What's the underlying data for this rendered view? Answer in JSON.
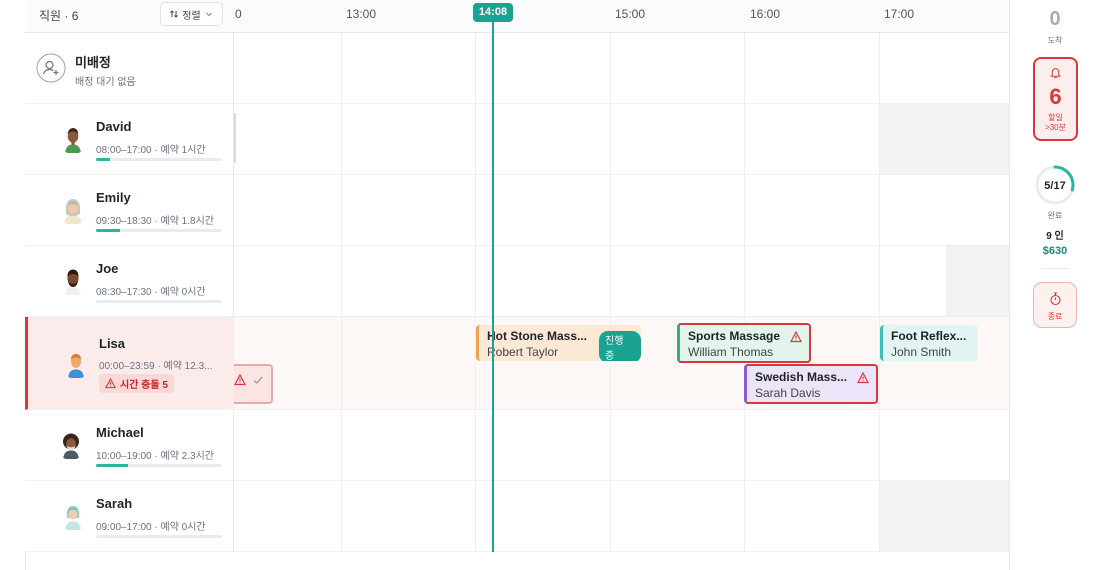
{
  "header": {
    "staff_title": "직원 · 6",
    "sort_label": "정렬",
    "time_ticks": [
      "0",
      "13:00",
      "14:00",
      "15:00",
      "16:00",
      "17:00"
    ],
    "now_time": "14:08"
  },
  "unassigned": {
    "title": "미배정",
    "subtitle": "배정 대기 없음"
  },
  "staff": [
    {
      "name": "David",
      "meta": "08:00–17:00 · 예약 1시간",
      "progress": 0.11
    },
    {
      "name": "Emily",
      "meta": "09:30–18:30 · 예약 1.8시간",
      "progress": 0.19
    },
    {
      "name": "Joe",
      "meta": "08:30–17:30 · 예약 0시간",
      "progress": 0.0
    },
    {
      "name": "Lisa",
      "meta": "00:00–23:59 · 예약 12.3...",
      "conflict": "시간 충돌 5"
    },
    {
      "name": "Michael",
      "meta": "10:00–19:00 · 예약 2.3시간",
      "progress": 0.25
    },
    {
      "name": "Sarah",
      "meta": "09:00–17:00 · 예약 0시간",
      "progress": 0.0
    }
  ],
  "appointments": [
    {
      "title": "Hot Stone Mass...",
      "client": "Robert Taylor",
      "badge": "진행 중",
      "color": "#fbe9d6",
      "accent": "#f0a24e"
    },
    {
      "title": "Sports Massage",
      "client": "William Thomas",
      "color": "#e3f4ec",
      "accent": "#2fb184",
      "warning": true
    },
    {
      "title": "Swedish Mass...",
      "client": "Sarah Davis",
      "color": "#ece4f8",
      "accent": "#8a5cd6",
      "warning": true
    },
    {
      "title": "Foot Reflex...",
      "client": "John Smith",
      "color": "#e2f4f3",
      "accent": "#3cc0b8"
    }
  ],
  "sidebar": {
    "arrived_count": "0",
    "arrived_label": "도착",
    "alert_count": "6",
    "alert_label_1": "할일",
    "alert_label_2": ">30분",
    "done_ratio": "5/17",
    "done_fraction": 0.294,
    "done_label": "완료",
    "people": "9 인",
    "revenue": "$630",
    "end_label": "종료"
  },
  "colors": {
    "accent": "#1aa391",
    "danger": "#d9383a"
  }
}
